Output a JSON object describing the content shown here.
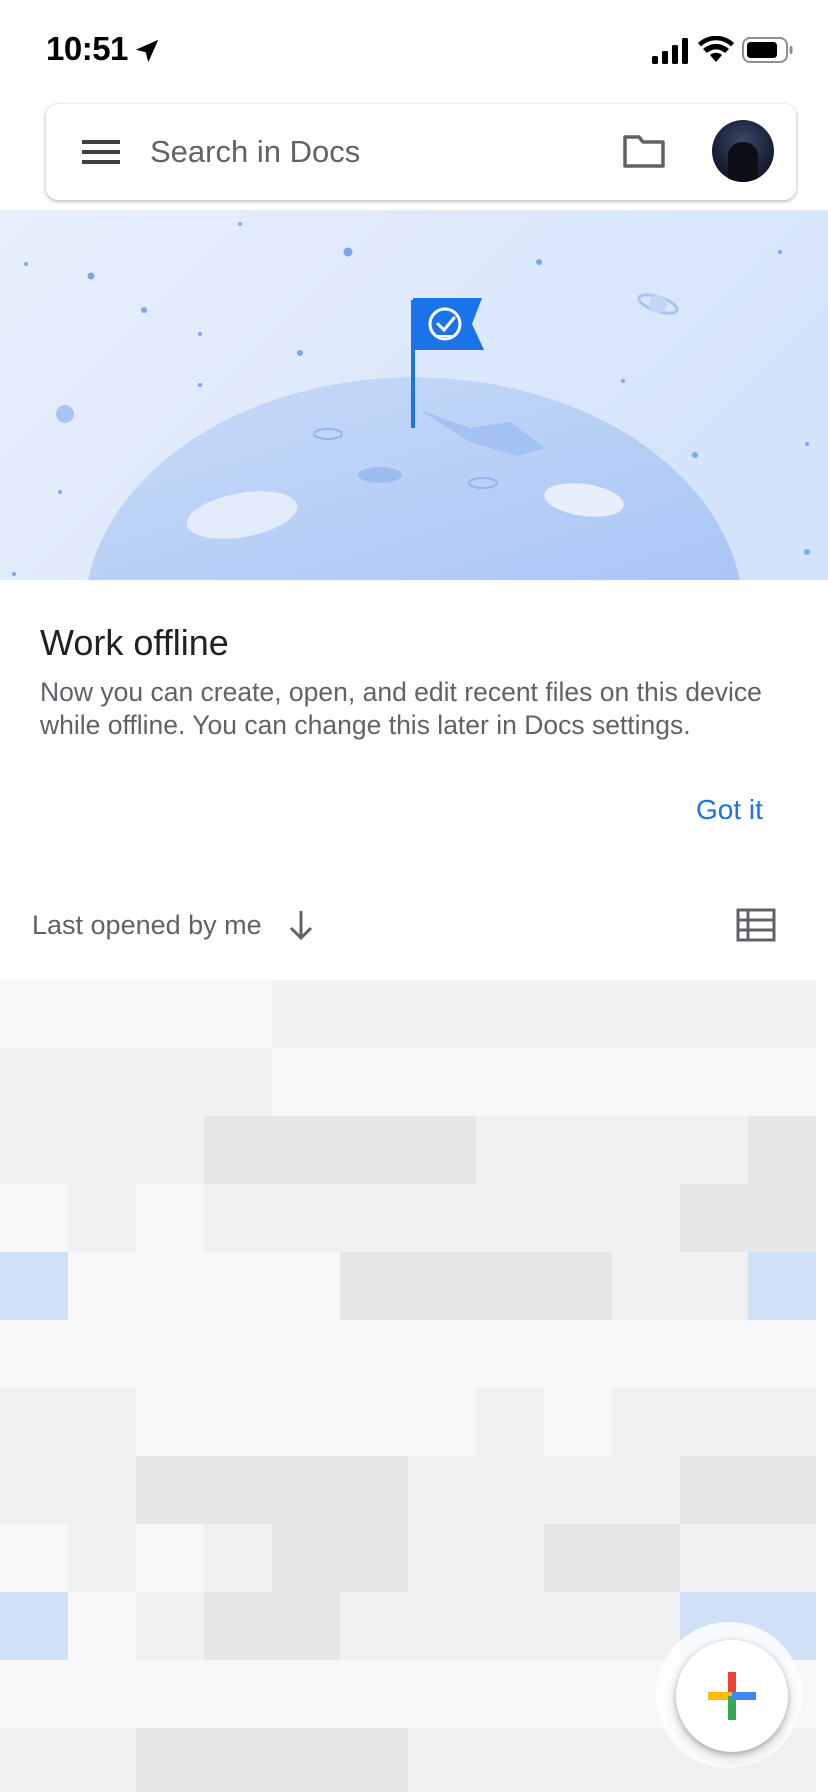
{
  "status_bar": {
    "time": "10:51",
    "icons": [
      "location-arrow-icon",
      "cellular-signal-icon",
      "wifi-icon",
      "battery-icon"
    ]
  },
  "search": {
    "placeholder": "Search in Docs",
    "icons": [
      "menu-icon",
      "folder-icon"
    ]
  },
  "offline_card": {
    "title": "Work offline",
    "body": "Now you can create, open, and edit recent files on this device while offline. You can change this later in Docs settings.",
    "action": "Got it",
    "illustration_icons": [
      "flag-check-icon",
      "planet-icon"
    ]
  },
  "sort": {
    "label": "Last opened by me",
    "icons": [
      "arrow-down-icon",
      "list-view-icon"
    ]
  },
  "fab": {
    "icon": "plus-icon",
    "colors": [
      "#ea4335",
      "#fbbc04",
      "#34a853",
      "#4285f4"
    ]
  },
  "colors": {
    "accent": "#1a73e8",
    "secondary_text": "#5f6368",
    "banner_bg": "#dbe7fb",
    "flag": "#1a73e8"
  }
}
